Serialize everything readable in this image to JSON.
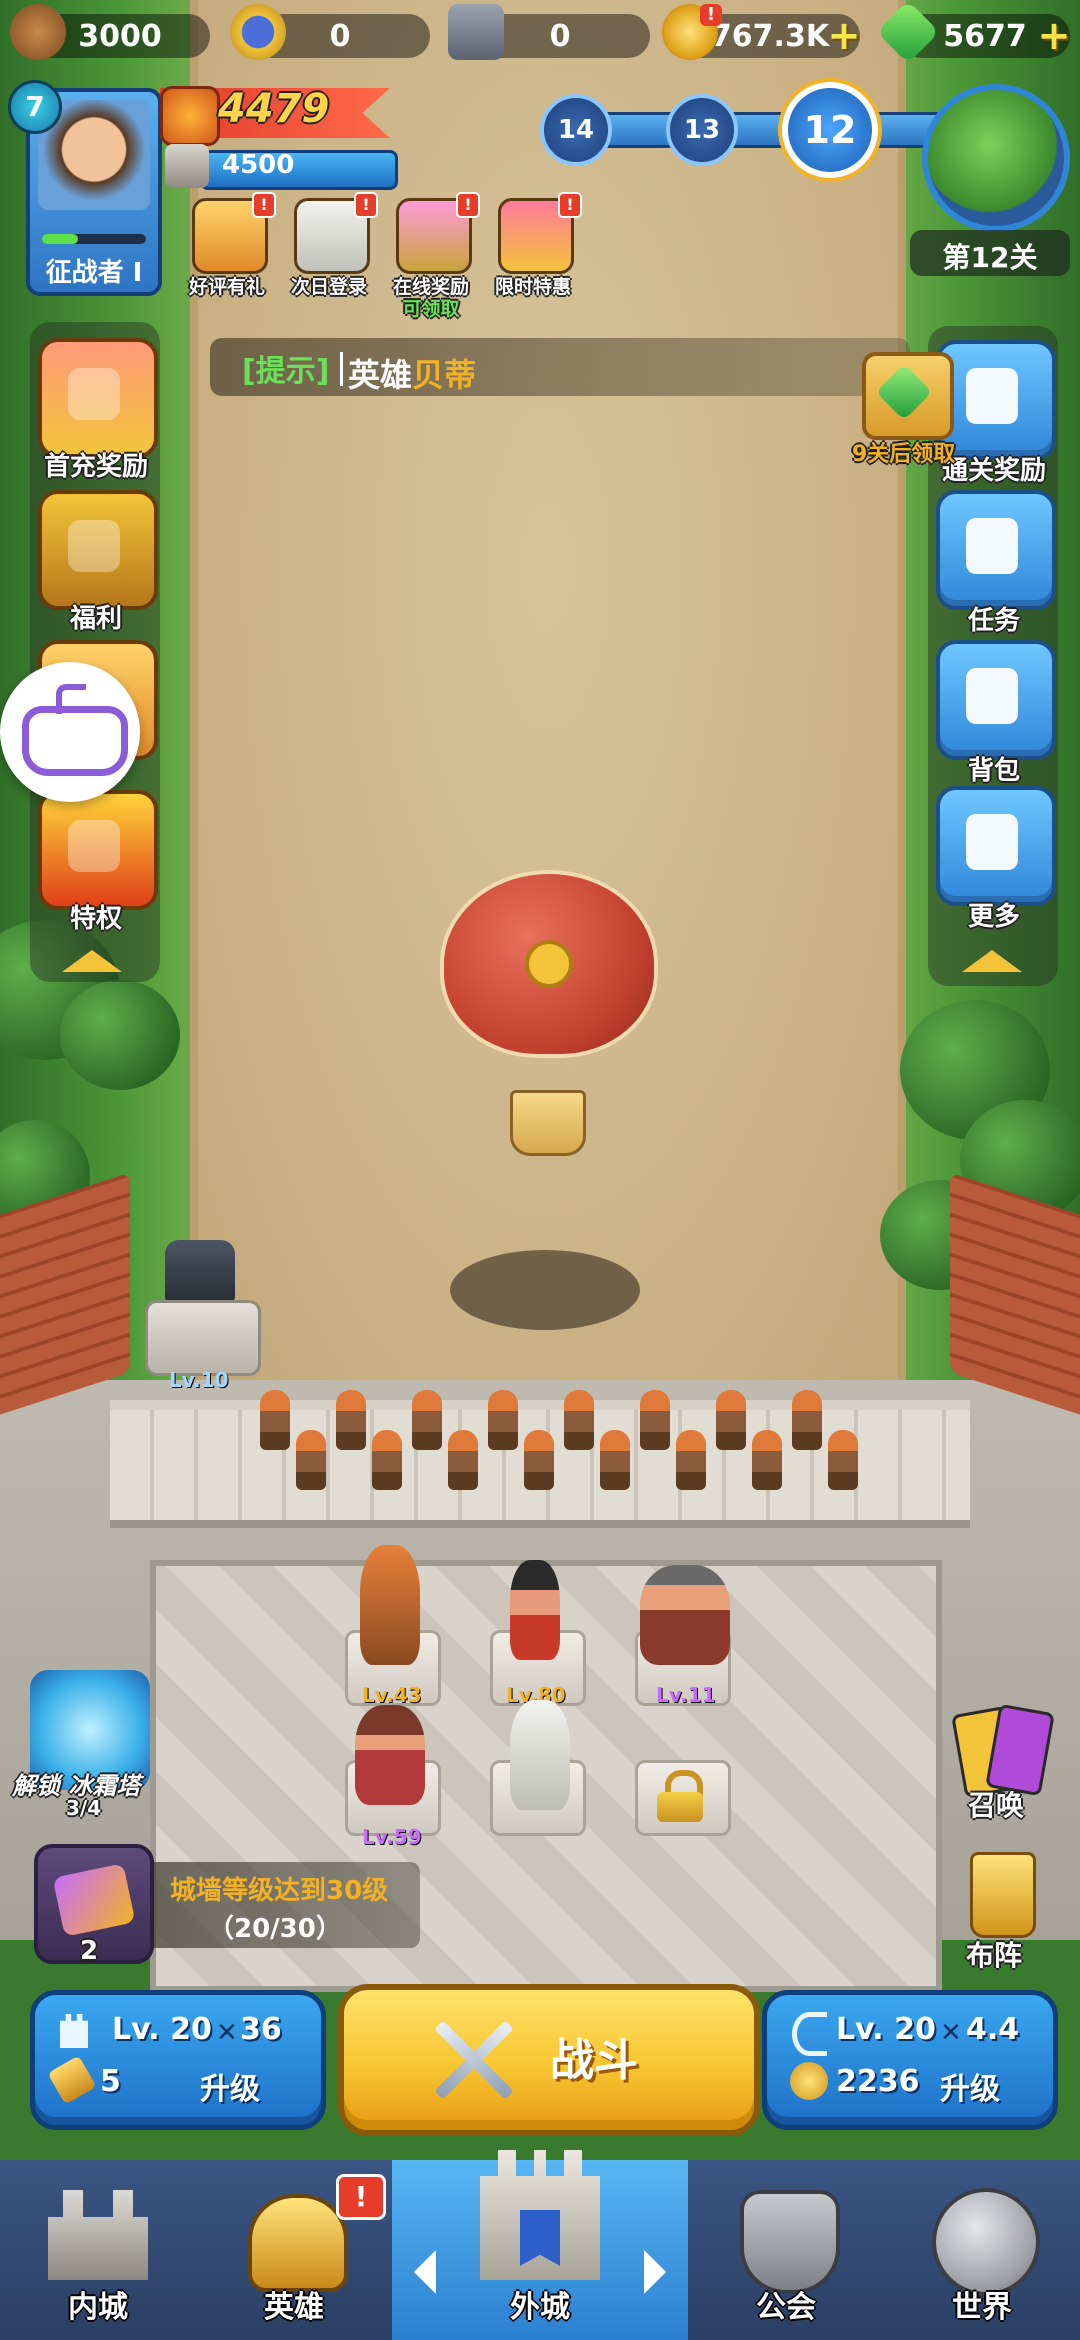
{
  "resources": {
    "wood": "3000",
    "medal": "0",
    "iron": "0",
    "gold": "767.3K",
    "gems": "5677"
  },
  "player": {
    "level": "7",
    "power": "4479",
    "castle_power": "4500",
    "rank_label": "征战者 Ⅰ"
  },
  "stage": {
    "nodes": [
      "14",
      "13",
      "12"
    ],
    "current_label": "第12关"
  },
  "top_events": [
    {
      "label": "好评有礼",
      "icon": "thumb-scroll-icon"
    },
    {
      "label": "次日登录",
      "icon": "wizard-icon"
    },
    {
      "label": "在线奖励",
      "icon": "treasure-chest-icon",
      "sub": "可领取"
    },
    {
      "label": "限时特惠",
      "icon": "gift-box-icon"
    }
  ],
  "hint": {
    "tag": "[提示]",
    "text_prefix": "英雄",
    "text_highlight": "贝蒂"
  },
  "left_menu": [
    {
      "label": "首充奖励",
      "icon": "girl-portrait-icon"
    },
    {
      "label": "福利",
      "icon": "crown-badge-icon"
    },
    {
      "label": "特权",
      "icon": "crown-shield-icon"
    }
  ],
  "right_menu": [
    {
      "label": "通关奖励",
      "icon": "gift-icon"
    },
    {
      "label": "任务",
      "icon": "clipboard-icon"
    },
    {
      "label": "背包",
      "icon": "backpack-icon"
    },
    {
      "label": "更多",
      "icon": "plus-icon"
    }
  ],
  "clear_reward_note": "9关后领取",
  "units": {
    "cannon_level": "Lv.10",
    "heroes": [
      {
        "level": "Lv.43"
      },
      {
        "level": "Lv.80"
      },
      {
        "level": "Lv.11"
      },
      {
        "level": "Lv.59"
      }
    ]
  },
  "ice_tower": {
    "label": "解锁 冰霜塔",
    "progress": "3/4"
  },
  "quest": {
    "text": "城墙等级达到30级",
    "progress": "（20/30）",
    "count": "2"
  },
  "summon": {
    "label": "召唤"
  },
  "formation": {
    "label": "布阵"
  },
  "wall_panel": {
    "level": "Lv. 20",
    "stat": "36",
    "cost": "5",
    "action": "升级"
  },
  "battle": {
    "label": "战斗"
  },
  "archer_panel": {
    "level": "Lv. 20",
    "stat": "4.4",
    "cost": "2236",
    "action": "升级"
  },
  "nav": [
    {
      "label": "内城"
    },
    {
      "label": "英雄",
      "badge": "!"
    },
    {
      "label": "外城"
    },
    {
      "label": "公会"
    },
    {
      "label": "世界"
    }
  ],
  "colors": {
    "gold_text": "#f3b223",
    "hint_green": "#6de05a",
    "power_red": "#e03a2a",
    "battle_yellow": "#f7c531",
    "panel_blue": "#2f86d8"
  }
}
